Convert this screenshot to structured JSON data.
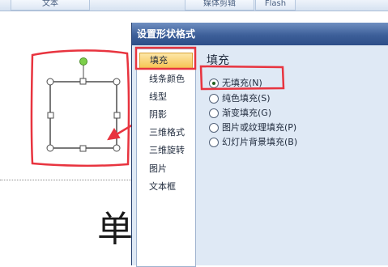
{
  "ribbon": {
    "tabs": [
      {
        "label": "文本"
      },
      {
        "label": "媒体剪辑"
      },
      {
        "label": "Flash"
      }
    ]
  },
  "slide": {
    "big_char": "单"
  },
  "dialog": {
    "title": "设置形状格式",
    "nav": [
      {
        "label": "填充",
        "selected": true
      },
      {
        "label": "线条颜色"
      },
      {
        "label": "线型"
      },
      {
        "label": "阴影"
      },
      {
        "label": "三维格式"
      },
      {
        "label": "三维旋转"
      },
      {
        "label": "图片"
      },
      {
        "label": "文本框"
      }
    ],
    "section_title": "填充",
    "options": [
      {
        "label": "无填充(N)",
        "selected": true
      },
      {
        "label": "纯色填充(S)"
      },
      {
        "label": "渐变填充(G)"
      },
      {
        "label": "图片或纹理填充(P)"
      },
      {
        "label": "幻灯片背景填充(B)"
      }
    ]
  },
  "colors": {
    "annotation_red": "#e8343f",
    "handle_green": "#7ccf4a",
    "dialog_title_bg": "#3d5f99",
    "selected_nav_bg": "#f6c453"
  }
}
